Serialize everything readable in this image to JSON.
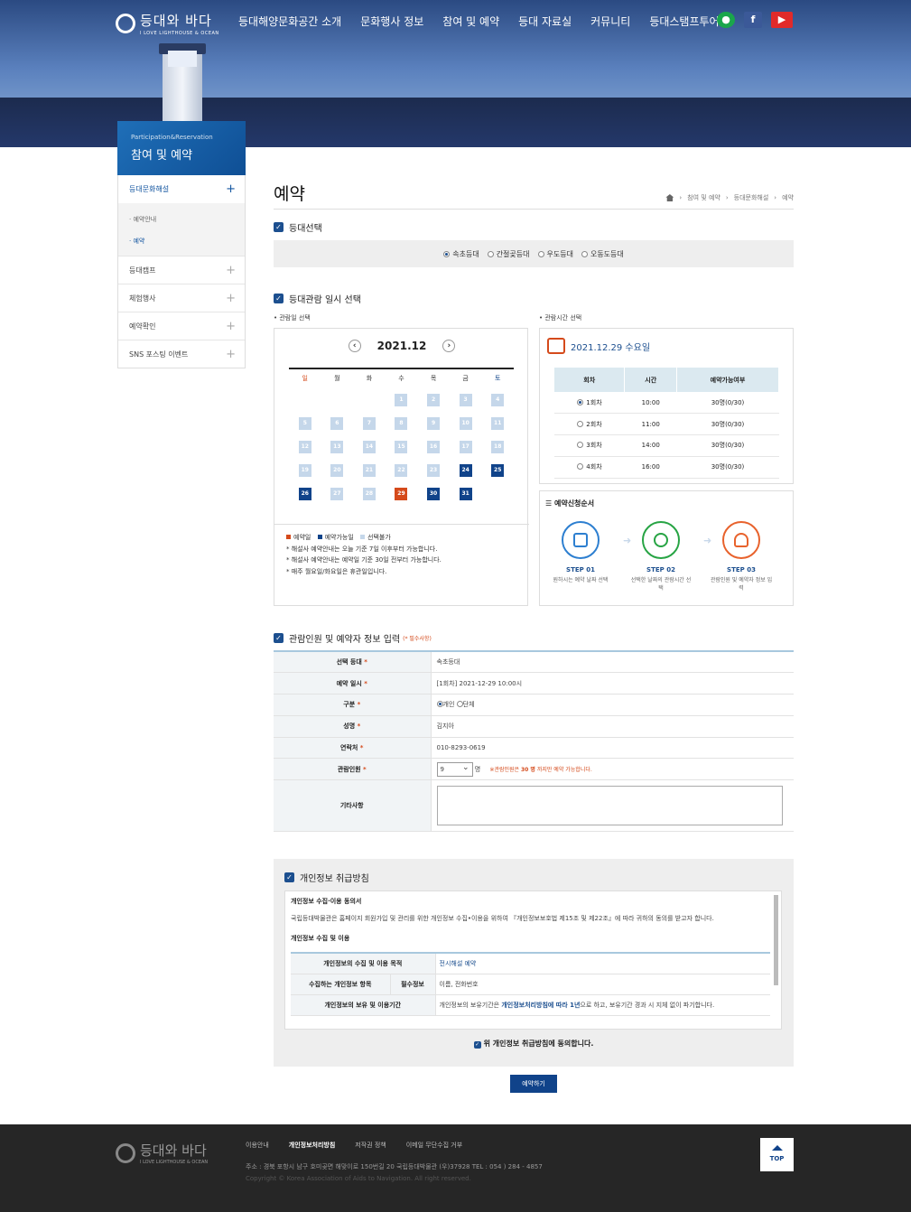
{
  "header": {
    "logo_title": "등대와 바다",
    "logo_sub": "I LOVE LIGHTHOUSE & OCEAN",
    "nav": [
      "등대해양문화공간 소개",
      "문화행사 정보",
      "참여 및 예약",
      "등대 자료실",
      "커뮤니티",
      "등대스탬프투어"
    ],
    "sns": [
      "kakao-icon",
      "facebook-icon",
      "youtube-icon"
    ]
  },
  "lnb": {
    "en": "Participation&Reservation",
    "ko": "참여 및 예약",
    "items": [
      {
        "label": "등대문화해설",
        "subs": [
          "· 예약안내",
          "· 예약"
        ]
      },
      {
        "label": "등대캠프"
      },
      {
        "label": "체험행사"
      },
      {
        "label": "예약확인"
      },
      {
        "label": "SNS 포스팅 이벤트"
      }
    ]
  },
  "page": {
    "title": "예약",
    "breadcrumb": [
      "참여 및 예약",
      "등대문화해설",
      "예약"
    ]
  },
  "lighthouse": {
    "section": "등대선택",
    "options": [
      "속초등대",
      "간절곶등대",
      "우도등대",
      "오동도등대"
    ],
    "selected": "속초등대"
  },
  "schedule": {
    "section": "등대관람 일시 선택",
    "date_label": "• 관람일 선택",
    "time_label": "• 관람시간 선택",
    "month": "2021.12",
    "dow": [
      "일",
      "월",
      "화",
      "수",
      "목",
      "금",
      "토"
    ],
    "legend": [
      "예약일",
      "예약가능일",
      "선택불가"
    ],
    "notes": [
      "* 해설사 예약안내는 오늘 기준 7일 이후부터 가능합니다.",
      "* 해설사 예약안내는 예약일 기준 30일 전부터 가능합니다.",
      "* 매주 월요일/화요일은 휴관일입니다."
    ],
    "selected_date": "2021.12.29  수요일",
    "time_headers": [
      "회차",
      "시간",
      "예약가능여부"
    ],
    "times": [
      {
        "round": "1회차",
        "time": "10:00",
        "avail": "30명(0/30)"
      },
      {
        "round": "2회차",
        "time": "11:00",
        "avail": "30명(0/30)"
      },
      {
        "round": "3회차",
        "time": "14:00",
        "avail": "30명(0/30)"
      },
      {
        "round": "4회차",
        "time": "16:00",
        "avail": "30명(0/30)"
      }
    ],
    "steps_title": "예약신청순서",
    "steps": [
      {
        "no": "STEP 01",
        "desc": "원하시는 예약 날짜 선택"
      },
      {
        "no": "STEP 02",
        "desc": "선택한 날짜의 관람시간 선택"
      },
      {
        "no": "STEP 03",
        "desc": "관람인원 및 예약자 정보 입력"
      }
    ]
  },
  "form": {
    "section": "관람인원 및 예약자 정보 입력",
    "required_note": "(* 필수사항)",
    "lighthouse_label": "선택 등대",
    "lighthouse": "속초등대",
    "datetime_label": "예약 일시",
    "datetime": "[1회차] 2021-12-29 10:00시",
    "type_label": "구분",
    "type_options": [
      "개인",
      "단체"
    ],
    "name_label": "성명",
    "name": "김지아",
    "phone_label": "연락처",
    "phone": "010-8293-0619",
    "people_label": "관람인원",
    "people": "9",
    "people_unit": "명",
    "people_note_pre": "※관람인원은 ",
    "people_note_num": "30 명",
    "people_note_post": " 까지만 예약 가능합니다.",
    "etc_label": "기타사항"
  },
  "privacy": {
    "section": "개인정보 취급방침",
    "title1": "개인정보 수집·이용 동의서",
    "para": "국립등대박물관은 홈페이지 회원가입 및 관리를 위한 개인정보 수집•이용을 위하여 『개인정보보호법 제15조 및 제22조』에 따라 귀하의 동의를 받고자 합니다.",
    "title2": "개인정보 수집 및 이용",
    "row1_h": "개인정보의 수집 및 이용 목적",
    "row1_v": "전시해설 예약",
    "row2_h": "수집하는 개인정보 항목",
    "row2_sub": "필수정보",
    "row2_v": "이름, 전화번호",
    "row3_h": "개인정보의 보유 및 이용기간",
    "row3_pre": "개인정보의 보유기간은 ",
    "row3_em": "개인정보처리방침에 따라 1년",
    "row3_post": "으로 하고, 보유기간 경과 시 지체 없이 파기합니다.",
    "agree": "위 개인정보 취급방침에 동의합니다."
  },
  "submit_label": "예약하기",
  "footer": {
    "links": [
      "이용안내",
      "개인정보처리방침",
      "저작권 정책",
      "이메일 무단수집 거부"
    ],
    "address": "주소 : 경북 포항시 남구 호미곶면 해맞이로 150번길 20 국립등대박물관 (우)37928   TEL : 054 ) 284 - 4857",
    "copyright": "Copyright © Korea Association of Aids to Navigation. All right reserved.",
    "top": "TOP"
  },
  "colors": {
    "brand": "#10438a",
    "accent": "#d54a1b",
    "available": "#10438a",
    "unavailable": "#c5d7ea"
  }
}
